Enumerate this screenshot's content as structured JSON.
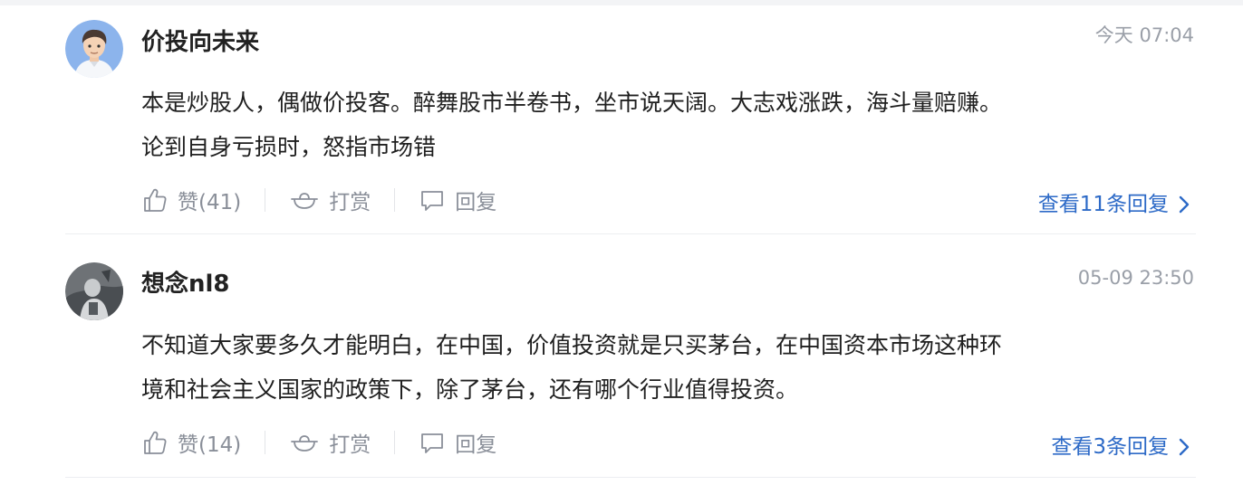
{
  "comments": [
    {
      "username": "价投向未来",
      "time": "今天 07:04",
      "text_line1": "本是炒股人，偶做价投客。醉舞股市半卷书，坐市说天阔。大志戏涨跌，海斗量赔赚。",
      "text_line2": "论到自身亏损时，怒指市场错",
      "like_label": "赞(41)",
      "tip_label": "打赏",
      "reply_label": "回复",
      "view_replies": "查看11条回复"
    },
    {
      "username": "想念nl8",
      "time": "05-09 23:50",
      "text_line1": "不知道大家要多久才能明白，在中国，价值投资就是只买茅台，在中国资本市场这种环",
      "text_line2": "境和社会主义国家的政策下，除了茅台，还有哪个行业值得投资。",
      "like_label": "赞(14)",
      "tip_label": "打赏",
      "reply_label": "回复",
      "view_replies": "查看3条回复"
    }
  ],
  "icons": {
    "like": "thumbs-up-icon",
    "tip": "tip-bowl-icon",
    "reply": "speech-bubble-icon",
    "more": "chevron-right-icon"
  },
  "colors": {
    "username": "#222222",
    "text": "#1f1f1f",
    "muted": "#8a8f99",
    "time": "#9a9fa8",
    "link": "#2d6ac7",
    "separator": "#eceef1"
  }
}
